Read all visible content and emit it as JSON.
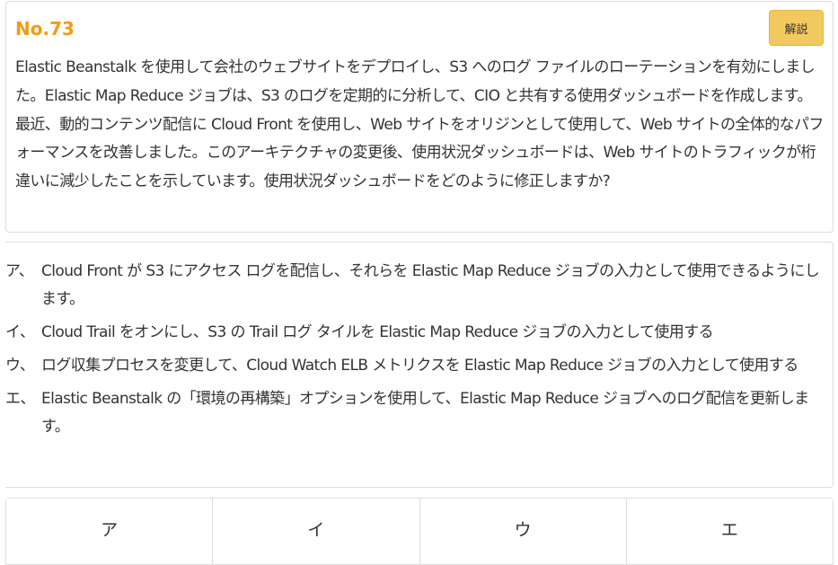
{
  "question": {
    "number": "No.73",
    "explain_label": "解説",
    "text": "Elastic Beanstalk を使用して会社のウェブサイトをデプロイし、S3 へのログ ファイルのローテーションを有効にしました。Elastic Map Reduce ジョブは、S3 のログを定期的に分析して、CIO と共有する使用ダッシュボードを作成します。最近、動的コンテンツ配信に Cloud Front を使用し、Web サイトをオリジンとして使用して、Web サイトの全体的なパフォーマンスを改善しました。このアーキテクチャの変更後、使用状況ダッシュボードは、Web サイトのトラフィックが桁違いに減少したことを示しています。使用状況ダッシュボードをどのように修正しますか?"
  },
  "options": [
    {
      "label": "ア、",
      "text": "Cloud Front が S3 にアクセス ログを配信し、それらを Elastic Map Reduce ジョブの入力として使用できるようにします。"
    },
    {
      "label": "イ、",
      "text": "Cloud Trail をオンにし、S3 の Trail ログ タイルを Elastic Map Reduce ジョブの入力として使用する"
    },
    {
      "label": "ウ、",
      "text": "ログ収集プロセスを変更して、Cloud Watch ELB メトリクスを Elastic Map Reduce ジョブの入力として使用する"
    },
    {
      "label": "エ、",
      "text": "Elastic Beanstalk の「環境の再構築」オプションを使用して、Elastic Map Reduce ジョブへのログ配信を更新します。"
    }
  ],
  "answers": [
    "ア",
    "イ",
    "ウ",
    "エ"
  ],
  "colors": {
    "number": "#f39c12",
    "explain_button": "#f2c95e",
    "border": "#dddddd",
    "text": "#333333"
  }
}
